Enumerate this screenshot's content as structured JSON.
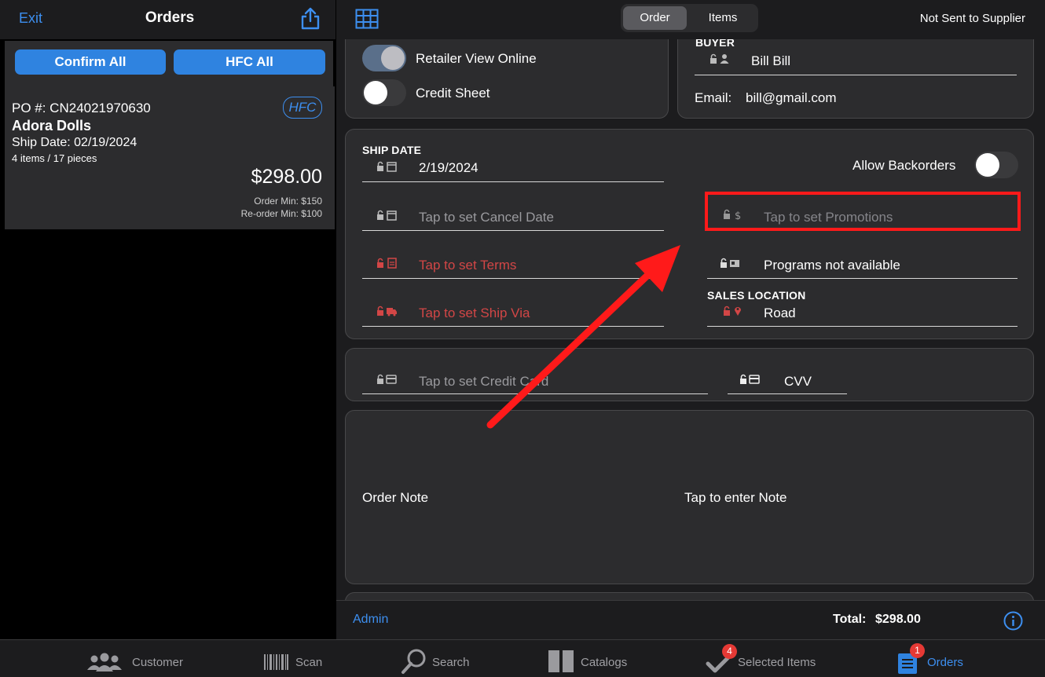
{
  "left_header": {
    "exit_label": "Exit",
    "title": "Orders",
    "share_icon": "share-icon"
  },
  "left_buttons": {
    "confirm_all": "Confirm All",
    "hfc_all": "HFC All"
  },
  "po_card": {
    "po_number": "PO #: CN24021970630",
    "company": "Adora Dolls",
    "ship_date": "Ship Date: 02/19/2024",
    "items": "4 items / 17 pieces",
    "badge": "HFC",
    "amount": "$298.00",
    "order_min": "Order Min: $150",
    "reorder_min": "Re-order Min: $100"
  },
  "header": {
    "segment_order": "Order",
    "segment_items": "Items",
    "status": "Not Sent to Supplier"
  },
  "toggles": {
    "retailer_view": "Retailer View Online",
    "credit_sheet": "Credit Sheet",
    "allow_backorders": "Allow Backorders"
  },
  "buyer": {
    "section": "BUYER",
    "name": "Bill Bill",
    "email_label": "Email:",
    "email": "bill@gmail.com"
  },
  "details": {
    "ship_date_label": "SHIP DATE",
    "ship_date": "2/19/2024",
    "cancel_date": "Tap to set Cancel Date",
    "terms": "Tap to set Terms",
    "ship_via": "Tap to set Ship Via",
    "promotions": "Tap to set Promotions",
    "programs": "Programs not available",
    "sales_location_label": "SALES LOCATION",
    "sales_location": "Road"
  },
  "payment": {
    "credit_card": "Tap to set Credit Card",
    "cvv": "CVV"
  },
  "note": {
    "label": "Order Note",
    "placeholder": "Tap to enter Note"
  },
  "footer": {
    "admin": "Admin",
    "total_label": "Total:",
    "total_value": "$298.00"
  },
  "tabs": [
    {
      "label": "Customer",
      "icon": "customers-icon"
    },
    {
      "label": "Scan",
      "icon": "barcode-icon"
    },
    {
      "label": "Search",
      "icon": "search-icon"
    },
    {
      "label": "Catalogs",
      "icon": "catalogs-icon"
    },
    {
      "label": "Selected Items",
      "icon": "checkmark-icon",
      "badge": "4"
    },
    {
      "label": "Orders",
      "icon": "orders-icon",
      "badge": "1"
    }
  ],
  "colors": {
    "accent": "#3d8ff0",
    "alert_red": "#d24646",
    "annotation_red": "#ff1a1a",
    "panel": "#2c2c2e"
  }
}
